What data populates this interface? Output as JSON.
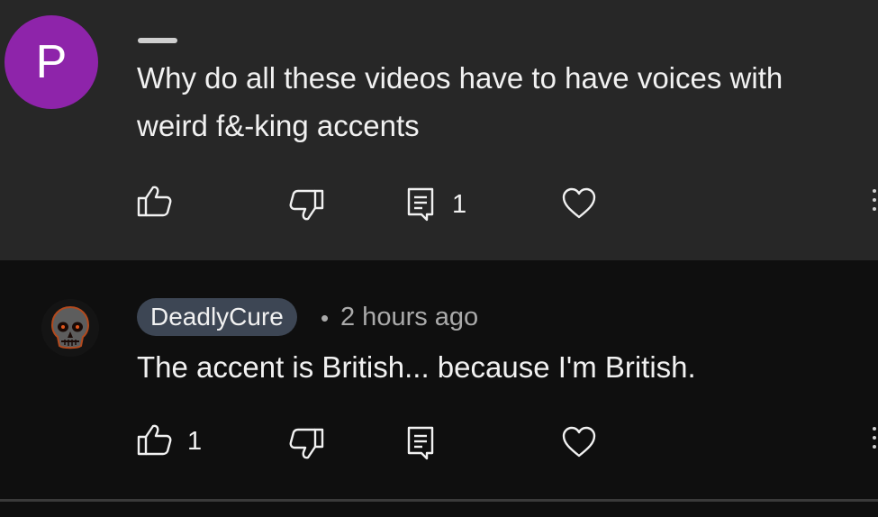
{
  "comments": [
    {
      "avatar_letter": "P",
      "avatar_color": "#8e24aa",
      "text": "Why do all these videos have to have voices with weird f&-king accents",
      "like_count": "",
      "reply_count": "1"
    },
    {
      "author": "DeadlyCure",
      "separator": "•",
      "timestamp": "2 hours ago",
      "text": "The accent is British... because I'm British.",
      "like_count": "1",
      "reply_count": ""
    }
  ],
  "colors": {
    "background": "#0f0f0f",
    "highlighted_comment_bg": "#272727",
    "author_chip_bg": "#3d4654",
    "secondary_text": "#aaaaaa"
  },
  "icons": [
    "thumbs-up-icon",
    "thumbs-down-icon",
    "reply-icon",
    "heart-icon",
    "more-options-icon"
  ]
}
